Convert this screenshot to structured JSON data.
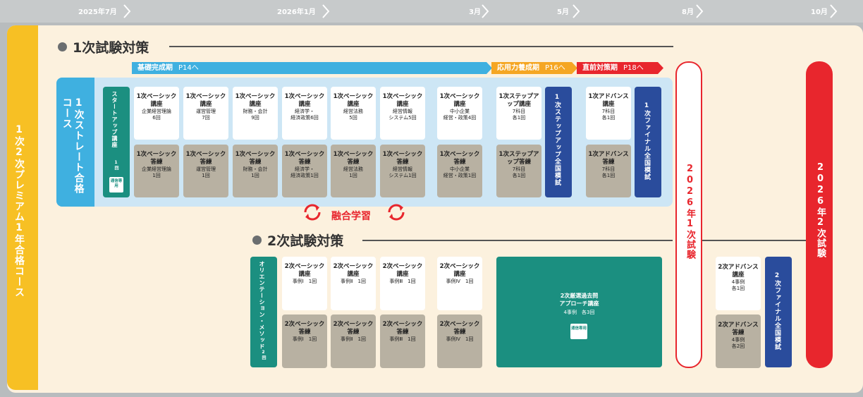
{
  "timeline": {
    "ticks": [
      "2025年7月",
      "2026年1月",
      "3月",
      "5月",
      "8月",
      "10月"
    ]
  },
  "course_title": "1次2次プレミアム1年合格コース",
  "section1": {
    "title": "1次試験対策"
  },
  "section2": {
    "title": "2次試験対策"
  },
  "phases": [
    {
      "label": "基礎完成期",
      "page": "P14へ",
      "color": "#3fb0e0"
    },
    {
      "label": "応用力養成期",
      "page": "P16へ",
      "color": "#f5a623"
    },
    {
      "label": "直前対策期",
      "page": "P18へ",
      "color": "#e8262d"
    }
  ],
  "straight_course": {
    "title": "1次ストレート合格コース"
  },
  "startup": {
    "title": "スタートアップ講座",
    "count": "1回",
    "badge": "通信専用"
  },
  "course1": [
    {
      "name": "1次ベーシック講座",
      "sub": "企業経営理論",
      "count": "6回",
      "drill": "1次ベーシック答練",
      "drill_sub": "企業経営理論",
      "drill_count": "1回"
    },
    {
      "name": "1次ベーシック講座",
      "sub": "運営管理",
      "count": "7回",
      "drill": "1次ベーシック答練",
      "drill_sub": "運営管理",
      "drill_count": "1回"
    },
    {
      "name": "1次ベーシック講座",
      "sub": "財務・会計",
      "count": "9回",
      "drill": "1次ベーシック答練",
      "drill_sub": "財務・会計",
      "drill_count": "1回"
    },
    {
      "name": "1次ベーシック講座",
      "sub": "経済学・",
      "count": "経済政策6回",
      "drill": "1次ベーシック答練",
      "drill_sub": "経済学・",
      "drill_count": "経済政策1回"
    },
    {
      "name": "1次ベーシック講座",
      "sub": "経営法務",
      "count": "5回",
      "drill": "1次ベーシック答練",
      "drill_sub": "経営法務",
      "drill_count": "1回"
    },
    {
      "name": "1次ベーシック講座",
      "sub": "経営情報",
      "count": "システム5回",
      "drill": "1次ベーシック答練",
      "drill_sub": "経営情報",
      "drill_count": "システム1回"
    },
    {
      "name": "1次ベーシック講座",
      "sub": "中小企業",
      "count": "経営・政策4回",
      "drill": "1次ベーシック答練",
      "drill_sub": "中小企業",
      "drill_count": "経営・政策1回"
    },
    {
      "name": "1次ステップアップ講座",
      "sub": "7科目",
      "count": "各1回",
      "drill": "1次ステップアップ答練",
      "drill_sub": "7科目",
      "drill_count": "各1回"
    },
    {
      "name": "1次アドバンス講座",
      "sub": "7科目",
      "count": "各1回",
      "drill": "1次アドバンス答練",
      "drill_sub": "7科目",
      "drill_count": "各1回"
    }
  ],
  "stepup_mock": "1次ステップアップ全国模試",
  "final_mock1": "1次ファイナル全国模試",
  "fusion": "融合学習",
  "orientation": {
    "title": "オリエンテーション・メソッド",
    "count": "2回"
  },
  "course2": [
    {
      "name": "2次ベーシック講座",
      "sub": "事例Ⅰ　1回",
      "drill": "2次ベーシック答練",
      "drill_sub": "事例Ⅰ　1回"
    },
    {
      "name": "2次ベーシック講座",
      "sub": "事例Ⅱ　1回",
      "drill": "2次ベーシック答練",
      "drill_sub": "事例Ⅱ　1回"
    },
    {
      "name": "2次ベーシック講座",
      "sub": "事例Ⅲ　1回",
      "drill": "2次ベーシック答練",
      "drill_sub": "事例Ⅲ　1回"
    },
    {
      "name": "2次ベーシック講座",
      "sub": "事例Ⅳ　1回",
      "drill": "2次ベーシック答練",
      "drill_sub": "事例Ⅳ　1回"
    }
  ],
  "kakomon": {
    "title1": "2次厳選過去問",
    "title2": "アプローチ講座",
    "sub": "4事例　各3回",
    "badge": "通信専用"
  },
  "advance2": {
    "name": "2次アドバンス講座",
    "sub": "4事例",
    "count": "各1回",
    "drill": "2次アドバンス答練",
    "drill_sub": "4事例",
    "drill_count": "各2回"
  },
  "final_mock2": "2次ファイナル全国模試",
  "exam1": "2026年1次試験",
  "exam2": "2026年2次試験"
}
